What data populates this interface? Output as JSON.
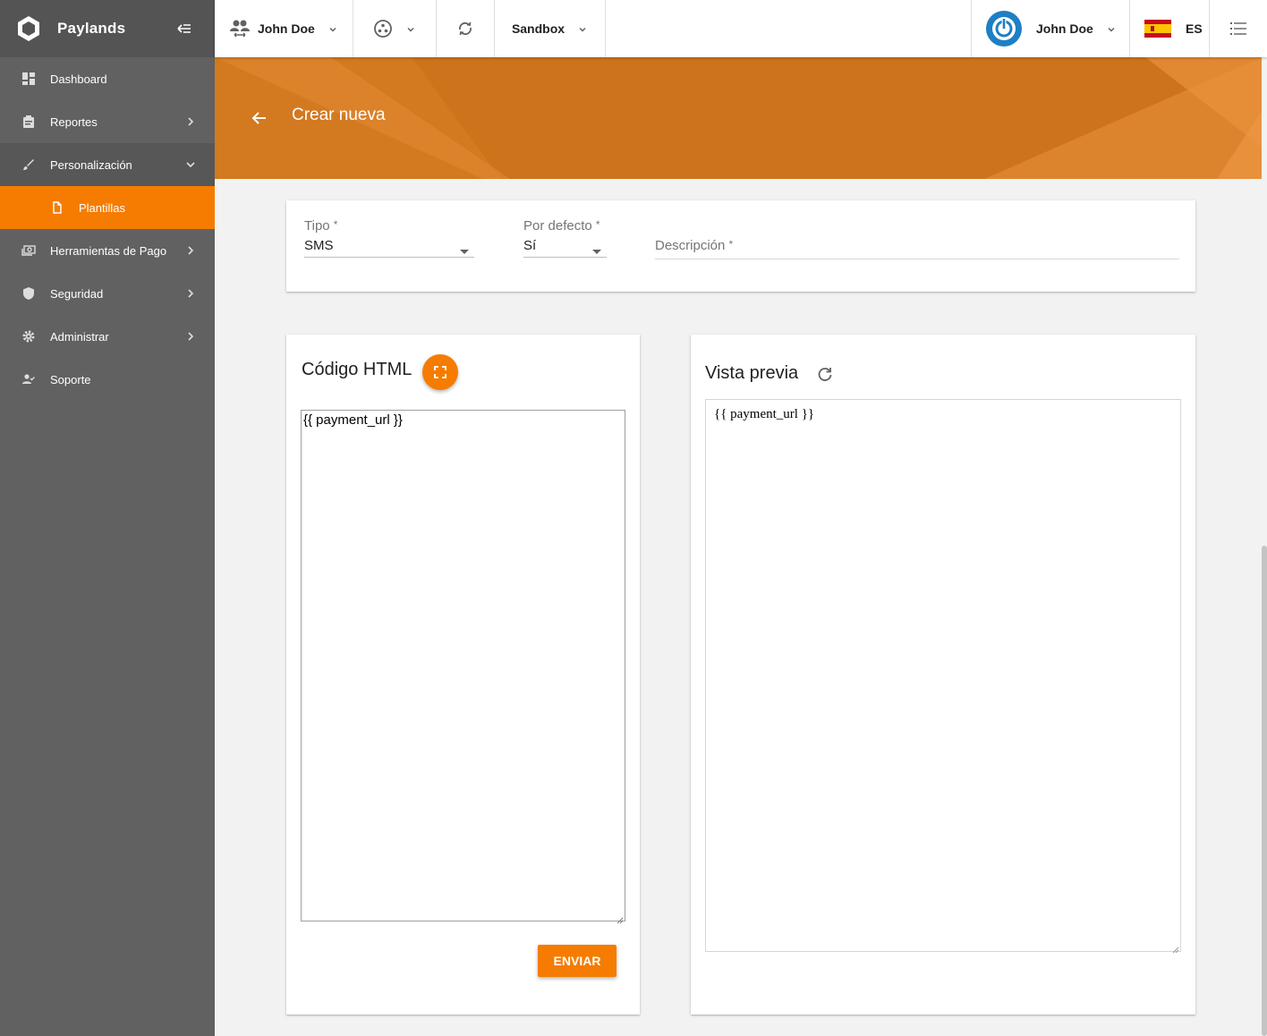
{
  "sidebar": {
    "brand": "Paylands",
    "items": [
      {
        "label": "Dashboard"
      },
      {
        "label": "Reportes"
      },
      {
        "label": "Personalización"
      },
      {
        "label": "Plantillas"
      },
      {
        "label": "Herramientas de Pago"
      },
      {
        "label": "Seguridad"
      },
      {
        "label": "Administrar"
      },
      {
        "label": "Soporte"
      }
    ]
  },
  "topbar": {
    "customer": "John Doe",
    "environment": "Sandbox",
    "account": "John Doe",
    "language": "ES"
  },
  "banner": {
    "title": "Crear nueva"
  },
  "form": {
    "tipo_label": "Tipo",
    "tipo_value": "SMS",
    "default_label": "Por defecto",
    "default_value": "Sí",
    "description_label": "Descripción",
    "required_mark": "*"
  },
  "code": {
    "title": "Código HTML",
    "content": "{{ payment_url }}",
    "send_label": "ENVIAR"
  },
  "preview": {
    "title": "Vista previa",
    "content": "{{ payment_url }}"
  },
  "colors": {
    "accent": "#f57c00",
    "banner": "#cc731c",
    "sidebar": "#616161"
  }
}
